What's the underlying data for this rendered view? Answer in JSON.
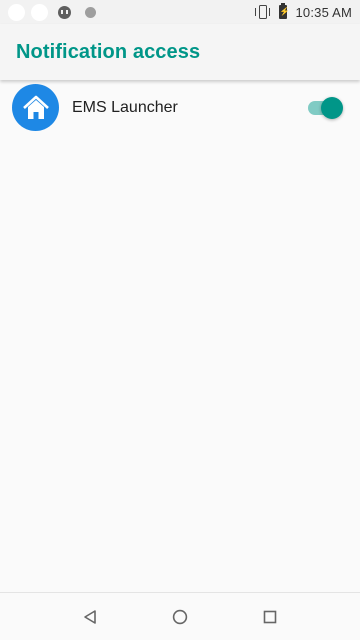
{
  "status_bar": {
    "time": "10:35 AM",
    "icons": [
      "notification-dot-icon",
      "notification-dot-icon",
      "hangouts-icon",
      "notification-circle-icon",
      "vibrate-icon",
      "battery-charging-icon"
    ]
  },
  "app_bar": {
    "title": "Notification access",
    "accent_color": "#009688"
  },
  "list": {
    "items": [
      {
        "label": "EMS Launcher",
        "icon": "home-icon",
        "icon_color": "#1e88e5",
        "enabled": true
      }
    ]
  },
  "nav_bar": {
    "buttons": [
      "back-icon",
      "home-circle-icon",
      "recents-icon"
    ]
  }
}
